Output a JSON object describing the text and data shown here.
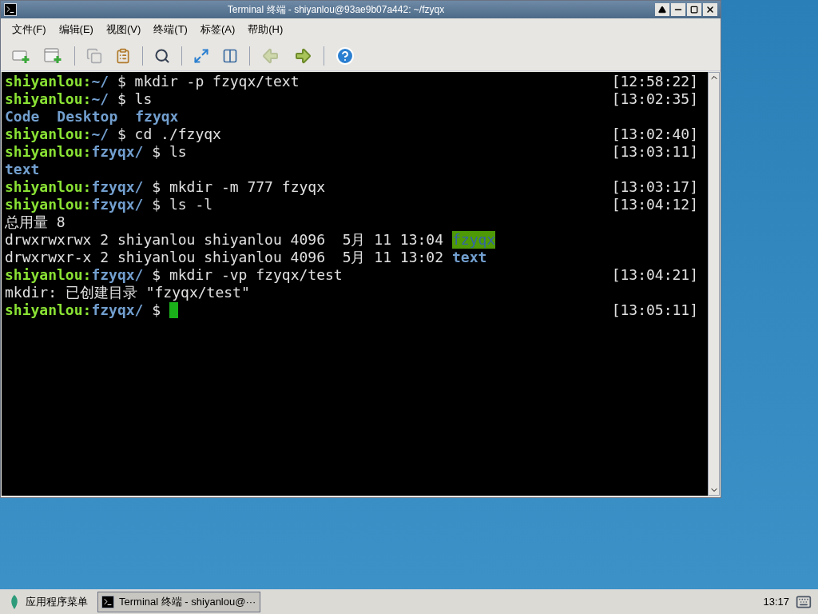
{
  "window": {
    "title": "Terminal 终端 - shiyanlou@93ae9b07a442: ~/fzyqx"
  },
  "menu": [
    "文件(F)",
    "编辑(E)",
    "视图(V)",
    "终端(T)",
    "标签(A)",
    "帮助(H)"
  ],
  "toolbar": [
    [
      {
        "kind": "new_tab",
        "disabled": false
      },
      {
        "kind": "new_window",
        "disabled": false
      }
    ],
    [
      {
        "kind": "copy",
        "disabled": true
      },
      {
        "kind": "paste",
        "disabled": false
      }
    ],
    [
      {
        "kind": "search",
        "disabled": false
      }
    ],
    [
      {
        "kind": "fullscreen",
        "disabled": false
      },
      {
        "kind": "panes",
        "disabled": false
      }
    ],
    [
      {
        "kind": "back",
        "disabled": true
      },
      {
        "kind": "forward",
        "disabled": false
      }
    ],
    [
      {
        "kind": "help",
        "disabled": false
      }
    ]
  ],
  "terminal": {
    "lines": [
      {
        "kind": "prompt",
        "user": "shiyanlou:",
        "path": "~/",
        "command": "$ mkdir -p fzyqx/text",
        "time": "[12:58:22]",
        "cursor": false
      },
      {
        "kind": "prompt",
        "user": "shiyanlou:",
        "path": "~/",
        "command": "$ ls",
        "time": "[13:02:35]",
        "cursor": false
      },
      {
        "kind": "listing",
        "items": [
          "Code",
          "Desktop",
          "fzyqx"
        ]
      },
      {
        "kind": "prompt",
        "user": "shiyanlou:",
        "path": "~/",
        "command": "$ cd ./fzyqx",
        "time": "[13:02:40]",
        "cursor": false
      },
      {
        "kind": "prompt",
        "user": "shiyanlou:",
        "path": "fzyqx/",
        "command": "$ ls",
        "time": "[13:03:11]",
        "cursor": false
      },
      {
        "kind": "listing",
        "items": [
          "text"
        ]
      },
      {
        "kind": "prompt",
        "user": "shiyanlou:",
        "path": "fzyqx/",
        "command": "$ mkdir -m 777 fzyqx",
        "time": "[13:03:17]",
        "cursor": false
      },
      {
        "kind": "prompt",
        "user": "shiyanlou:",
        "path": "fzyqx/",
        "command": "$ ls -l",
        "time": "[13:04:12]",
        "cursor": false
      },
      {
        "kind": "output",
        "text": "总用量 8"
      },
      {
        "kind": "entry",
        "text": "drwxrwxrwx 2 shiyanlou shiyanlou 4096  5月 11 13:04",
        "name": "fzyqx",
        "highlighted": true
      },
      {
        "kind": "entry",
        "text": "drwxrwxr-x 2 shiyanlou shiyanlou 4096  5月 11 13:02",
        "name": "text",
        "highlighted": false
      },
      {
        "kind": "prompt",
        "user": "shiyanlou:",
        "path": "fzyqx/",
        "command": "$ mkdir -vp fzyqx/test",
        "time": "[13:04:21]",
        "cursor": false
      },
      {
        "kind": "output",
        "text": "mkdir: 已创建目录 \"fzyqx/test\""
      },
      {
        "kind": "prompt",
        "user": "shiyanlou:",
        "path": "fzyqx/",
        "command": "$",
        "time": "[13:05:11]",
        "cursor": true
      }
    ]
  },
  "taskbar": {
    "app_menu": "应用程序菜单",
    "tasks": [
      {
        "label": "Terminal 终端 - shiyanlou@···",
        "selected": true
      }
    ],
    "clock": "13:17"
  }
}
